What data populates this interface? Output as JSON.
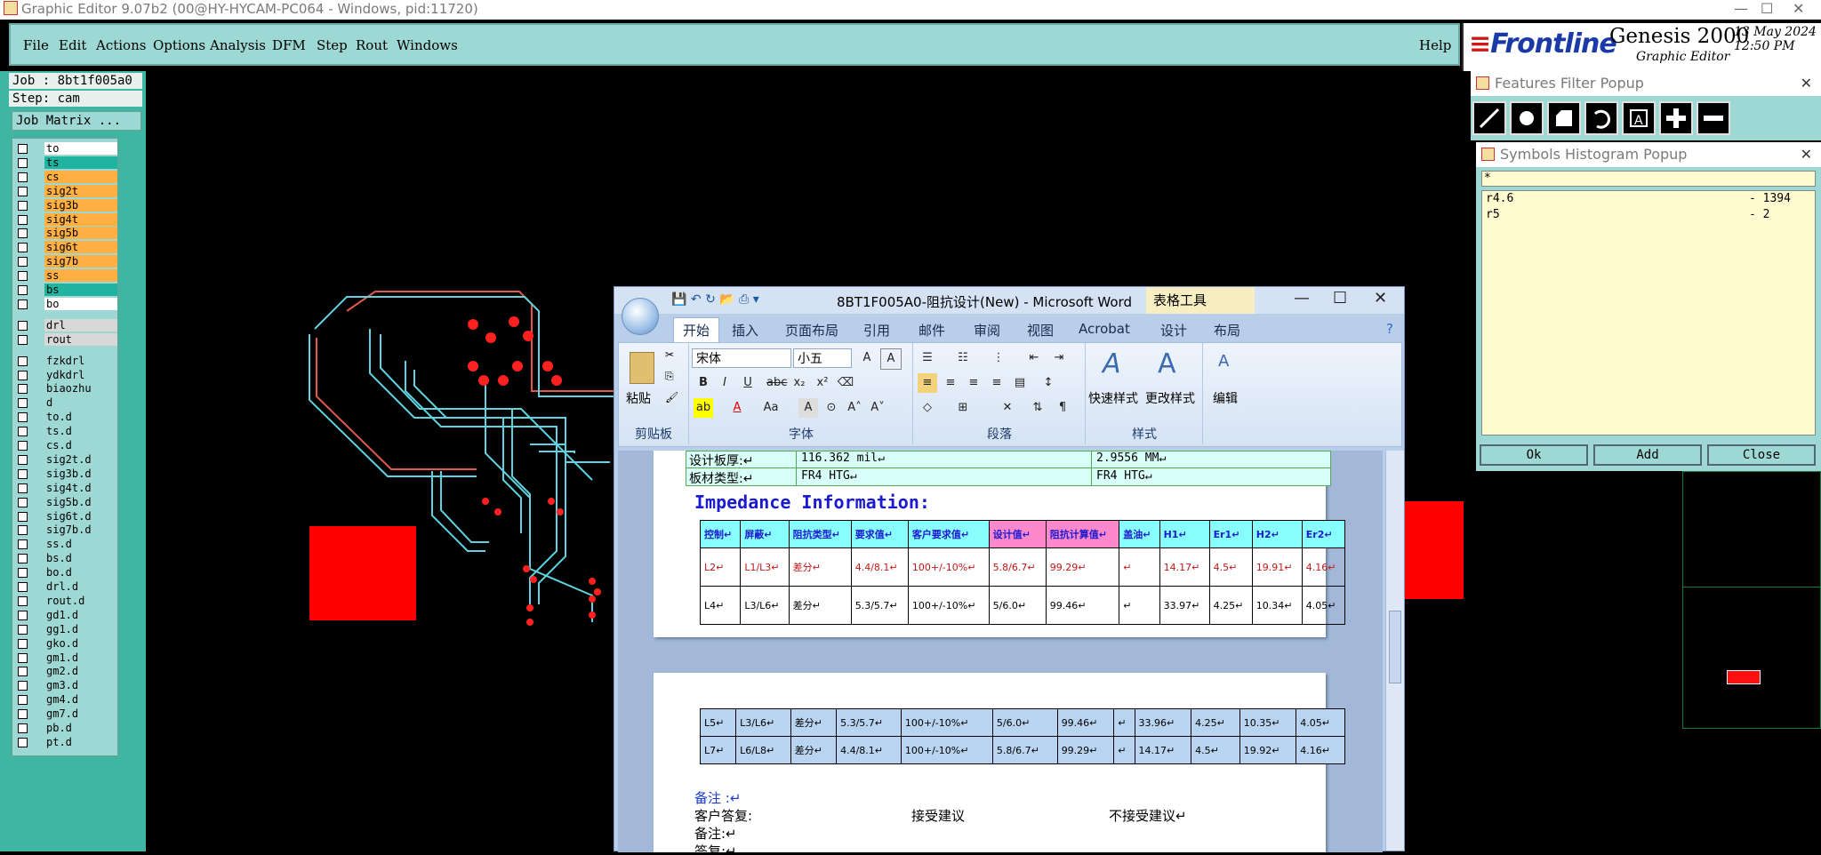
{
  "genesis": {
    "title": "Graphic Editor 9.07b2 (00@HY-HYCAM-PC064 - Windows, pid:11720)",
    "menu": [
      "File",
      "Edit",
      "Actions",
      "Options",
      "Analysis",
      "DFM",
      "Step",
      "Rout",
      "Windows"
    ],
    "help": "Help",
    "brand": "Frontline",
    "product": "Genesis 2000",
    "subtitle": "Graphic Editor",
    "date": "13 May 2024",
    "time": "12:50 PM",
    "job": "Job : 8bt1f005a0",
    "step": "Step: cam",
    "job_matrix": "Job Matrix ...",
    "layers": [
      {
        "name": "to",
        "color": "#ffffff"
      },
      {
        "name": "ts",
        "color": "#1fb3a0"
      },
      {
        "name": "cs",
        "color": "#ffb040"
      },
      {
        "name": "sig2t",
        "color": "#ffb040"
      },
      {
        "name": "sig3b",
        "color": "#ffb040"
      },
      {
        "name": "sig4t",
        "color": "#ffb040"
      },
      {
        "name": "sig5b",
        "color": "#ffb040"
      },
      {
        "name": "sig6t",
        "color": "#ffb040"
      },
      {
        "name": "sig7b",
        "color": "#ffb040"
      },
      {
        "name": "ss",
        "color": "#ffb040"
      },
      {
        "name": "bs",
        "color": "#1fb3a0"
      },
      {
        "name": "bo",
        "color": "#ffffff"
      },
      {
        "name": "drl",
        "color": "#d8d8d8"
      },
      {
        "name": "rout",
        "color": "#d8d8d8"
      },
      {
        "name": "fzkdrl",
        "color": "#9ed8d4"
      },
      {
        "name": "ydkdrl",
        "color": "#9ed8d4"
      },
      {
        "name": "biaozhu",
        "color": "#9ed8d4"
      },
      {
        "name": "d",
        "color": "#9ed8d4"
      },
      {
        "name": "to.d",
        "color": "#9ed8d4"
      },
      {
        "name": "ts.d",
        "color": "#9ed8d4"
      },
      {
        "name": "cs.d",
        "color": "#9ed8d4"
      },
      {
        "name": "sig2t.d",
        "color": "#9ed8d4"
      },
      {
        "name": "sig3b.d",
        "color": "#9ed8d4"
      },
      {
        "name": "sig4t.d",
        "color": "#9ed8d4"
      },
      {
        "name": "sig5b.d",
        "color": "#9ed8d4"
      },
      {
        "name": "sig6t.d",
        "color": "#9ed8d4"
      },
      {
        "name": "sig7b.d",
        "color": "#9ed8d4"
      },
      {
        "name": "ss.d",
        "color": "#9ed8d4"
      },
      {
        "name": "bs.d",
        "color": "#9ed8d4"
      },
      {
        "name": "bo.d",
        "color": "#9ed8d4"
      },
      {
        "name": "drl.d",
        "color": "#9ed8d4"
      },
      {
        "name": "rout.d",
        "color": "#9ed8d4"
      },
      {
        "name": "gd1.d",
        "color": "#9ed8d4"
      },
      {
        "name": "gg1.d",
        "color": "#9ed8d4"
      },
      {
        "name": "gko.d",
        "color": "#9ed8d4"
      },
      {
        "name": "gm1.d",
        "color": "#9ed8d4"
      },
      {
        "name": "gm2.d",
        "color": "#9ed8d4"
      },
      {
        "name": "gm3.d",
        "color": "#9ed8d4"
      },
      {
        "name": "gm4.d",
        "color": "#9ed8d4"
      },
      {
        "name": "gm7.d",
        "color": "#9ed8d4"
      },
      {
        "name": "pb.d",
        "color": "#9ed8d4"
      },
      {
        "name": "pt.d",
        "color": "#9ed8d4"
      }
    ]
  },
  "features_filter": {
    "title": "Features Filter Popup",
    "tools": [
      "line-icon",
      "pad-icon",
      "surface-icon",
      "arc-icon",
      "text-icon",
      "add-icon",
      "minus-icon"
    ]
  },
  "symbols_histogram": {
    "title": "Symbols Histogram Popup",
    "filter": "*",
    "rows": [
      {
        "symbol": "r4.6",
        "count": "- 1394"
      },
      {
        "symbol": "r5",
        "count": "- 2"
      }
    ],
    "ok": "Ok",
    "add": "Add",
    "close": "Close"
  },
  "word": {
    "title": "8BT1F005A0-阻抗设计(New) - Microsoft Word",
    "table_tools": "表格工具",
    "tabs": [
      "开始",
      "插入",
      "页面布局",
      "引用",
      "邮件",
      "审阅",
      "视图",
      "Acrobat",
      "设计",
      "布局"
    ],
    "ribbon": {
      "paste": "粘贴",
      "clipboard": "剪贴板",
      "font_name": "宋体",
      "font_size": "小五",
      "font_group": "字体",
      "paragraph_group": "段落",
      "quick_style": "快速样式",
      "change_style": "更改样式",
      "style_group": "样式",
      "edit": "编辑"
    },
    "doc": {
      "row1_label": "设计板厚:↵",
      "row1_val": "116.362 mil↵",
      "row1_mm": "2.9556 MM↵",
      "row2_label": "板材类型:↵",
      "row2_val": "FR4 HTG↵",
      "row2_val2": "FR4 HTG↵",
      "heading": "Impedance Information:",
      "headers": [
        "控制↵",
        "屏蔽↵",
        "阻抗类型↵",
        "要求值↵",
        "客户要求值↵",
        "设计值↵",
        "阻抗计算值↵",
        "盖油↵",
        "H1↵",
        "Er1↵",
        "H2↵",
        "Er2↵"
      ],
      "rows_p1": [
        [
          "L2↵",
          "L1/L3↵",
          "差分↵",
          "4.4/8.1↵",
          "100+/-10%↵",
          "5.8/6.7↵",
          "99.29↵",
          "↵",
          "14.17↵",
          "4.5↵",
          "19.91↵",
          "4.16↵"
        ],
        [
          "L4↵",
          "L3/L6↵",
          "差分↵",
          "5.3/5.7↵",
          "100+/-10%↵",
          "5/6.0↵",
          "99.46↵",
          "↵",
          "33.97↵",
          "4.25↵",
          "10.34↵",
          "4.05↵"
        ]
      ],
      "rows_p2": [
        [
          "L5↵",
          "L3/L6↵",
          "差分↵",
          "5.3/5.7↵",
          "100+/-10%↵",
          "5/6.0↵",
          "99.46↵",
          "↵",
          "33.96↵",
          "4.25↵",
          "10.35↵",
          "4.05↵"
        ],
        [
          "L7↵",
          "L6/L8↵",
          "差分↵",
          "4.4/8.1↵",
          "100+/-10%↵",
          "5.8/6.7↵",
          "99.29↵",
          "↵",
          "14.17↵",
          "4.5↵",
          "19.92↵",
          "4.16↵"
        ]
      ],
      "note_label": "备注 :↵",
      "reply_label": "客户答复:",
      "accept": "接受建议",
      "reject": "不接受建议↵",
      "note2": "备注:↵",
      "sign": "签复:↵"
    }
  }
}
